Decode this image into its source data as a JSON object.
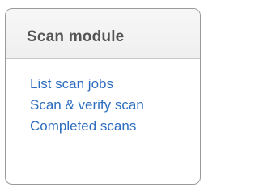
{
  "panel": {
    "title": "Scan module",
    "links": [
      {
        "label": "List scan jobs"
      },
      {
        "label": "Scan & verify scan"
      },
      {
        "label": "Completed scans"
      }
    ]
  },
  "colors": {
    "title": "#555555",
    "link": "#2f6ebf",
    "border": "#9a9a9a",
    "header_bg": "#f2f2f2"
  }
}
